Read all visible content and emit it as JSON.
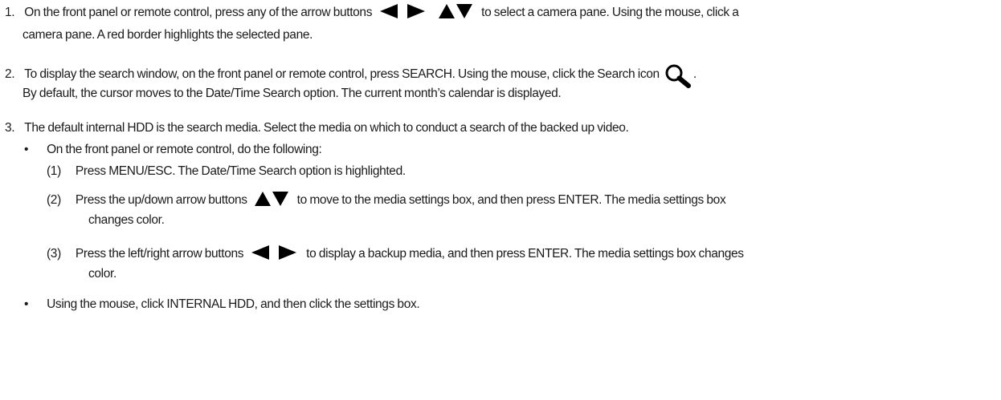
{
  "steps": [
    {
      "number": "1.",
      "line1_a": "On the front panel or remote control, press any of the arrow buttons",
      "line1_b": "to select a camera pane. Using the mouse, click a",
      "line2": "camera pane. A red border highlights the selected pane.",
      "icons": [
        "arrow-left-icon",
        "arrow-right-icon",
        "arrow-up-icon",
        "arrow-down-icon"
      ]
    },
    {
      "number": "2.",
      "line1_a": "To display the search window, on the front panel or remote control, press SEARCH. Using the mouse, click the Search icon",
      "line1_b": ".",
      "line2": "By default, the cursor moves to the Date/Time Search option. The current month’s calendar is displayed.",
      "icons": [
        "search-icon"
      ]
    },
    {
      "number": "3.",
      "line1": "The default internal HDD is the search media. Select the media on which to conduct a search of the backed up video.",
      "bullets": [
        {
          "bullet": "•",
          "text": "On the front panel or remote control, do the following:",
          "substeps": [
            {
              "number": "(1)",
              "line1": "Press MENU/ESC. The Date/Time Search option is highlighted."
            },
            {
              "number": "(2)",
              "line1_a": "Press the up/down arrow buttons",
              "line1_b": "to move to the media settings box, and then press ENTER. The media settings box",
              "line2": "changes color.",
              "icons": [
                "arrow-up-icon",
                "arrow-down-icon"
              ]
            },
            {
              "number": "(3)",
              "line1_a": "Press the left/right arrow buttons",
              "line1_b": "to display a backup media, and then press ENTER. The media settings box changes",
              "line2": "color.",
              "icons": [
                "arrow-left-icon",
                "arrow-right-icon"
              ]
            }
          ]
        },
        {
          "bullet": "•",
          "text": "Using the mouse, click INTERNAL HDD, and then click the settings box."
        }
      ]
    }
  ]
}
